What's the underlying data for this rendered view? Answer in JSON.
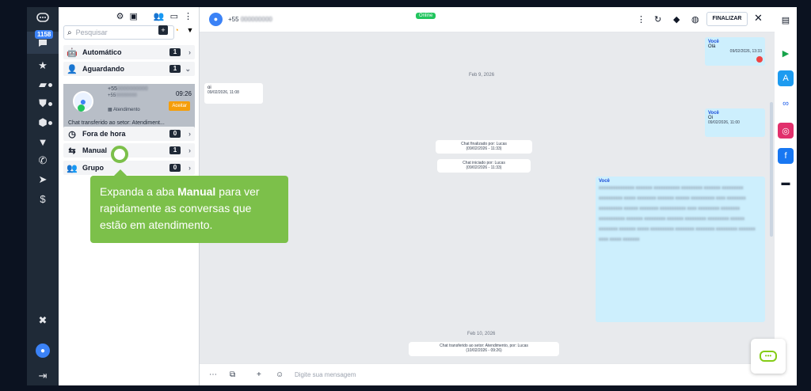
{
  "rail": {
    "badge": "1158",
    "icons": [
      "chat-icon",
      "star-icon",
      "ticket-icon",
      "shield-icon",
      "box-icon",
      "funnel-icon",
      "phone-icon",
      "send-icon",
      "money-bag-icon"
    ]
  },
  "list": {
    "search_placeholder": "Pesquisar",
    "groups": [
      {
        "label": "Automático",
        "count": "1",
        "icon": "robot-icon"
      },
      {
        "label": "Aguardando",
        "count": "1",
        "icon": "user-clock-icon"
      },
      {
        "label": "Fora de hora",
        "count": "0",
        "icon": "clock-icon"
      },
      {
        "label": "Manual",
        "count": "1",
        "icon": "people-arrows-icon"
      },
      {
        "label": "Grupo",
        "count": "0",
        "icon": "group-icon"
      }
    ],
    "card": {
      "name": "+55",
      "sub": "+55",
      "time": "09:26",
      "sector": "Atendimento",
      "accept": "Aceitar",
      "transfer": "Chat transferido ao setor: Atendiment..."
    }
  },
  "chat": {
    "number": "+55",
    "online": "Online",
    "finalize": "FINALIZAR",
    "date1": "Feb 9, 2026",
    "date2": "Feb 10, 2026",
    "msg_in": {
      "text": "oi",
      "ts": "09/02/2026, 11:08"
    },
    "msg_out1": {
      "who": "Você",
      "text": "Olá",
      "ts": "09/02/2026, 13:33"
    },
    "msg_out2": {
      "who": "Você",
      "text": "Oi",
      "ts": "09/02/2026, 11:00"
    },
    "msg_out3": {
      "who": "Você"
    },
    "sys1": {
      "title": "Chat finalizado por: Lucas",
      "ts": "(09/02/2026 - 11:33)"
    },
    "sys2": {
      "title": "Chat iniciado por: Lucas",
      "ts": "(09/02/2026 - 11:33)"
    },
    "sys3": {
      "title": "Chat transferido ao setor: Atendimento, por: Lucas",
      "ts": "(10/02/2026 - 09:26)"
    },
    "composer_placeholder": "Digite sua mensagem"
  },
  "tooltip": {
    "pre": "Expanda a aba ",
    "bold": "Manual",
    "post": " para ver rapidamente as conversas que estão em atendimento."
  },
  "colors": {
    "accent": "#7cc04a",
    "brand_blue": "#3b82f6",
    "accept": "#f59e0b"
  }
}
